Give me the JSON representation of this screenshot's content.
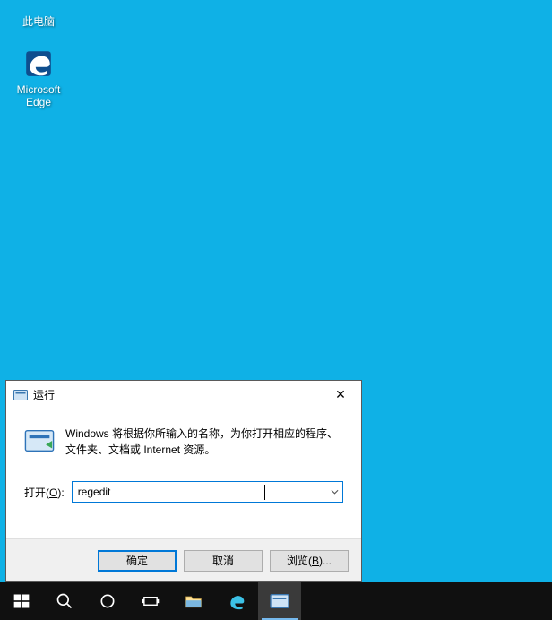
{
  "desktop": {
    "this_pc_label": "此电脑",
    "edge_label": "Microsoft\nEdge"
  },
  "run_dialog": {
    "title": "运行",
    "description": "Windows 将根据你所输入的名称，为你打开相应的程序、文件夹、文档或 Internet 资源。",
    "open_label_prefix": "打开(",
    "open_label_letter": "O",
    "open_label_suffix": "):",
    "input_value": "regedit",
    "ok_label": "确定",
    "cancel_label": "取消",
    "browse_label": "浏览(B)..."
  },
  "icons": {
    "close": "✕"
  }
}
